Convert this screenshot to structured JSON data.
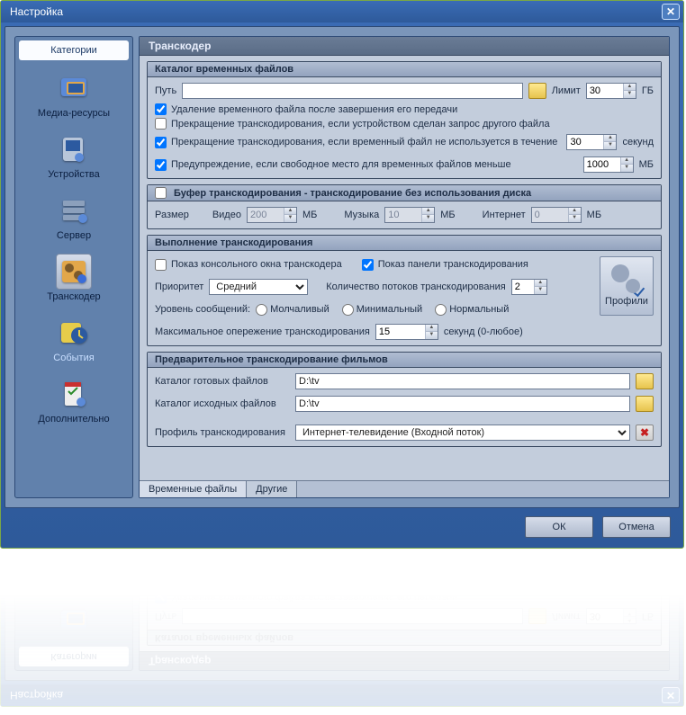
{
  "window": {
    "title": "Настройка"
  },
  "sidebar": {
    "header": "Категории",
    "items": [
      {
        "label": "Медиа-ресурсы"
      },
      {
        "label": "Устройства"
      },
      {
        "label": "Сервер"
      },
      {
        "label": "Транскодер"
      },
      {
        "label": "События"
      },
      {
        "label": "Дополнительно"
      }
    ]
  },
  "main": {
    "title": "Транскодер"
  },
  "temp_files": {
    "header": "Каталог временных файлов",
    "path_label": "Путь",
    "path_value": "",
    "limit_label": "Лимит",
    "limit_value": "30",
    "limit_unit": "ГБ",
    "chk_delete": "Удаление временного файла после завершения его передачи",
    "chk_stop_other": "Прекращение транскодирования, если устройством сделан запрос другого файла",
    "chk_stop_idle": "Прекращение транскодирования, если временный файл не используется в течение",
    "idle_value": "30",
    "idle_unit": "секунд",
    "chk_warn": "Предупреждение, если свободное место для временных файлов меньше",
    "warn_value": "1000",
    "warn_unit": "МБ"
  },
  "buffer": {
    "header": "Буфер транскодирования - транскодирование без использования диска",
    "size_label": "Размер",
    "video_label": "Видео",
    "video_value": "200",
    "unit_mb": "МБ",
    "music_label": "Музыка",
    "music_value": "10",
    "internet_label": "Интернет",
    "internet_value": "0"
  },
  "exec": {
    "header": "Выполнение транскодирования",
    "chk_console": "Показ консольного окна транскодера",
    "chk_panel": "Показ панели транскодирования",
    "priority_label": "Приоритет",
    "priority_value": "Средний",
    "threads_label": "Количество потоков транскодирования",
    "threads_value": "2",
    "verbose_label": "Уровень сообщений:",
    "silent": "Молчаливый",
    "minimal": "Минимальный",
    "normal": "Нормальный",
    "lead_label": "Максимальное опережение транскодирования",
    "lead_value": "15",
    "lead_suffix": "секунд (0-любое)",
    "profiles_btn": "Профили"
  },
  "pretrans": {
    "header": "Предварительное транскодирование фильмов",
    "out_label": "Каталог готовых файлов",
    "out_value": "D:\\tv",
    "in_label": "Каталог исходных файлов",
    "in_value": "D:\\tv",
    "profile_label": "Профиль транскодирования",
    "profile_value": "Интернет-телевидение (Входной поток)"
  },
  "tabs": {
    "temp": "Временные файлы",
    "other": "Другие"
  },
  "buttons": {
    "ok": "ОК",
    "cancel": "Отмена"
  }
}
